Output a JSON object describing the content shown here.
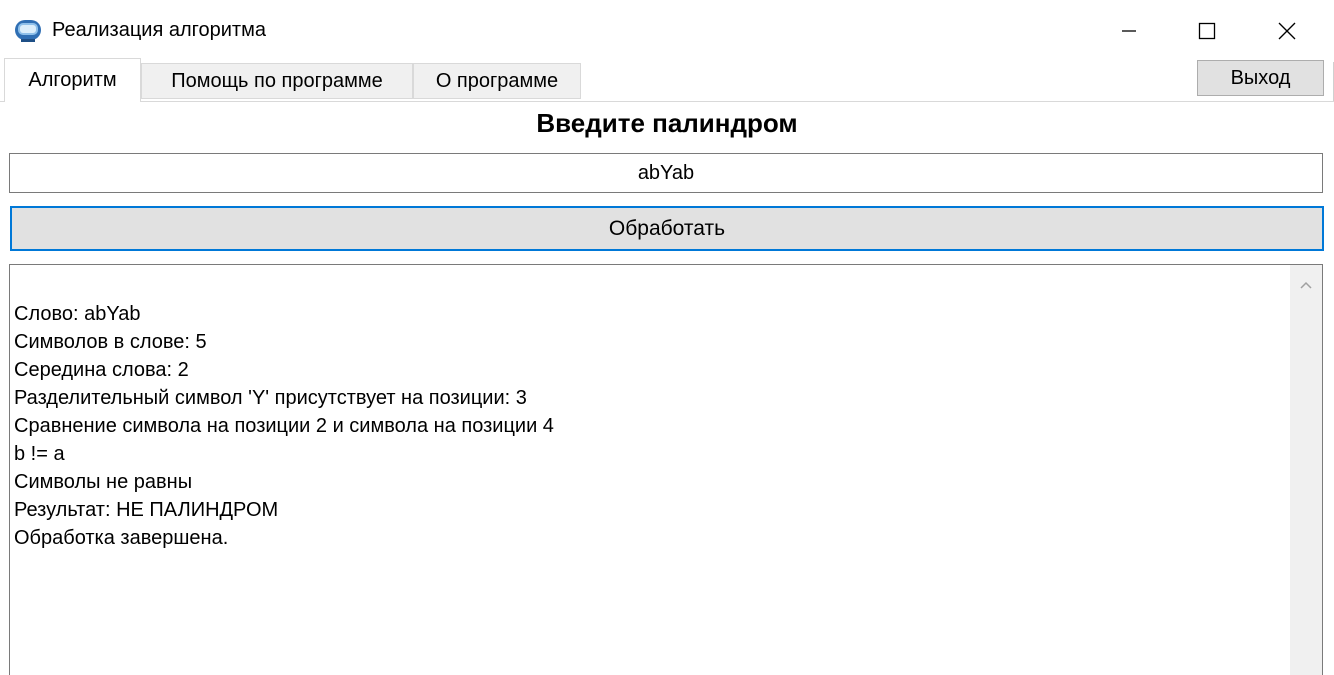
{
  "window": {
    "title": "Реализация алгоритма",
    "icon": "app-window-icon"
  },
  "tabs": [
    {
      "label": "Алгоритм",
      "active": true
    },
    {
      "label": "Помощь по программе",
      "active": false
    },
    {
      "label": "О программе",
      "active": false
    }
  ],
  "exit_button": {
    "label": "Выход"
  },
  "main": {
    "heading": "Введите палиндром",
    "input_value": "abYab",
    "process_button": "Обработать",
    "output_lines": [
      "Слово: abYab",
      "Символов в слове: 5",
      "Середина слова: 2",
      "Разделительный символ 'Y' присутствует на позиции: 3",
      "Сравнение символа на позиции 2 и символа на позиции 4",
      "b != a",
      "Символы не равны",
      "Результат: НЕ ПАЛИНДРОМ",
      "Обработка завершена."
    ]
  },
  "colors": {
    "accent": "#0078d7",
    "button_bg": "#e1e1e1",
    "tab_bg": "#f0f0f0"
  }
}
